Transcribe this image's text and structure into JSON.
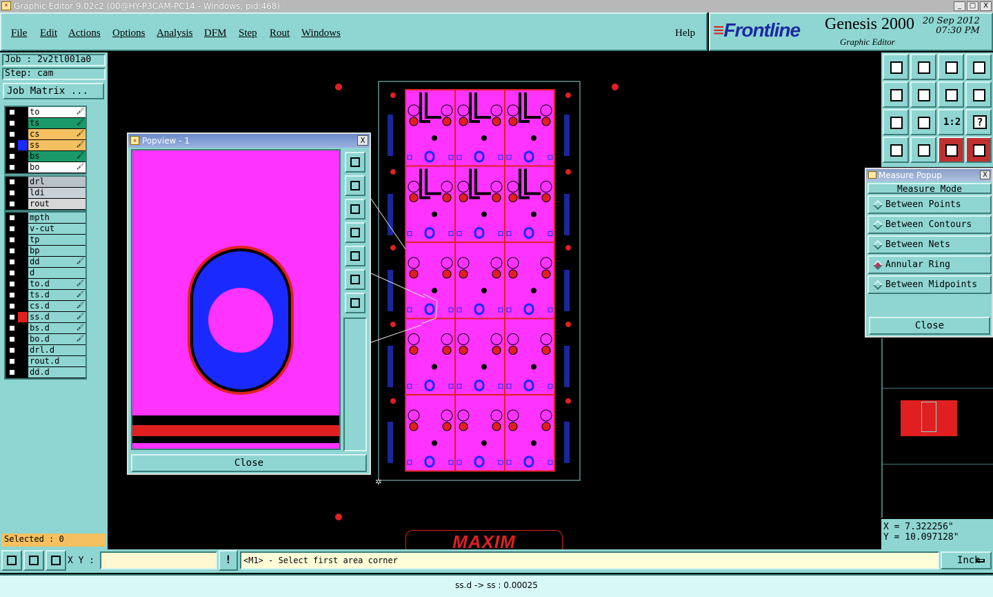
{
  "window": {
    "title": "Graphic Editor 9.02c2 (00@HY-P3CAM-PC14 - Windows, pid:468)",
    "controls": [
      "_",
      "□",
      "X"
    ]
  },
  "menu": {
    "items": [
      "File",
      "Edit",
      "Actions",
      "Options",
      "Analysis",
      "DFM",
      "Step",
      "Rout",
      "Windows"
    ],
    "help": "Help"
  },
  "brand": {
    "logo_mark": "≡",
    "logo_text": "Frontline",
    "product": "Genesis 2000",
    "date": "20 Sep 2012",
    "time": "07:30 PM",
    "subtitle": "Graphic Editor"
  },
  "left_panel": {
    "job": "Job : 2v2tl001a0",
    "step": "Step: cam",
    "job_matrix": "Job Matrix ...",
    "groups": [
      [
        {
          "name": "to",
          "color": "#ffffff",
          "swatch": "#000000",
          "icon": "🖌"
        },
        {
          "name": "ts",
          "color": "#1a9a6a",
          "swatch": "#000000",
          "icon": "🖌"
        },
        {
          "name": "cs",
          "color": "#f4c060",
          "swatch": "#000000",
          "icon": "🖌"
        },
        {
          "name": "ss",
          "color": "#f4c060",
          "swatch": "#1a2aff",
          "icon": "🖌"
        },
        {
          "name": "bs",
          "color": "#1a9a6a",
          "swatch": "#000000",
          "icon": "🖌"
        },
        {
          "name": "bo",
          "color": "#ffffff",
          "swatch": "#000000",
          "icon": "🖌"
        }
      ],
      [
        {
          "name": "drl",
          "color": "#b8c0c8",
          "swatch": "#000000",
          "icon": ""
        },
        {
          "name": "ldi",
          "color": "#c8d0d8",
          "swatch": "#000000",
          "icon": ""
        },
        {
          "name": "rout",
          "color": "#d8d8d8",
          "swatch": "#000000",
          "icon": ""
        }
      ],
      [
        {
          "name": "mpth",
          "color": "#8fd6d2",
          "swatch": "#000000",
          "icon": ""
        },
        {
          "name": "v-cut",
          "color": "#8fd6d2",
          "swatch": "#000000",
          "icon": ""
        },
        {
          "name": "tp",
          "color": "#8fd6d2",
          "swatch": "#000000",
          "icon": ""
        },
        {
          "name": "bp",
          "color": "#8fd6d2",
          "swatch": "#000000",
          "icon": ""
        },
        {
          "name": "dd",
          "color": "#8fd6d2",
          "swatch": "#000000",
          "icon": "🖌"
        },
        {
          "name": "d",
          "color": "#8fd6d2",
          "swatch": "#000000",
          "icon": ""
        },
        {
          "name": "to.d",
          "color": "#8fd6d2",
          "swatch": "#000000",
          "icon": "🖌"
        },
        {
          "name": "ts.d",
          "color": "#8fd6d2",
          "swatch": "#000000",
          "icon": "🖌"
        },
        {
          "name": "cs.d",
          "color": "#8fd6d2",
          "swatch": "#000000",
          "icon": "🖌"
        },
        {
          "name": "ss.d",
          "color": "#8fd6d2",
          "swatch": "#e02020",
          "icon": "🖌"
        },
        {
          "name": "bs.d",
          "color": "#8fd6d2",
          "swatch": "#000000",
          "icon": "🖌"
        },
        {
          "name": "bo.d",
          "color": "#8fd6d2",
          "swatch": "#000000",
          "icon": "🖌"
        },
        {
          "name": "drl.d",
          "color": "#8fd6d2",
          "swatch": "#000000",
          "icon": ""
        },
        {
          "name": "rout.d",
          "color": "#8fd6d2",
          "swatch": "#000000",
          "icon": ""
        },
        {
          "name": "dd.d",
          "color": "#8fd6d2",
          "swatch": "#000000",
          "icon": ""
        }
      ]
    ],
    "selected": "Selected : 0"
  },
  "popview": {
    "title": "Popview - 1",
    "close": "Close",
    "close_x": "X"
  },
  "measure": {
    "title": "Measure Popup",
    "close_x": "X",
    "header": "Measure Mode",
    "options": [
      {
        "label": "Between Points",
        "selected": false
      },
      {
        "label": "Between Contours",
        "selected": false
      },
      {
        "label": "Between Nets",
        "selected": false
      },
      {
        "label": "Annular Ring",
        "selected": true
      },
      {
        "label": "Between Midpoints",
        "selected": false
      }
    ],
    "close": "Close"
  },
  "tools": {
    "zoom_label": "1:2",
    "help_label": "?"
  },
  "coords": {
    "x": "X = 7.322256\"",
    "y": "Y = 10.097128\""
  },
  "bottom": {
    "xy_label": "X Y :",
    "xy_value": "",
    "bang": "!",
    "prompt": "<M1> - Select first area corner",
    "unit": "Inch",
    "status": "ss.d -> ss : 0.00025"
  },
  "board": {
    "logo": "MAXIM"
  },
  "colors": {
    "panel": "#8fd6d2",
    "copper": "#ff33ff",
    "pad": "#e02020",
    "via": "#1a2aff"
  }
}
